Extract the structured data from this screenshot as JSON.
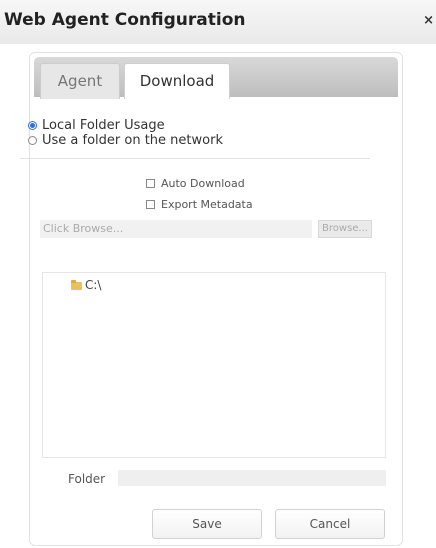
{
  "window": {
    "title": "Web Agent Configuration",
    "close_glyph": "×"
  },
  "tabs": [
    {
      "label": "Agent",
      "active": false
    },
    {
      "label": "Download",
      "active": true
    }
  ],
  "storage": {
    "options": [
      {
        "label": "Local Folder Usage",
        "selected": true
      },
      {
        "label": "Use a folder on the network",
        "selected": false
      }
    ]
  },
  "checkboxes": [
    {
      "label": "Auto Download",
      "checked": false
    },
    {
      "label": "Export Metadata",
      "checked": false
    }
  ],
  "browse": {
    "placeholder": "Click Browse...",
    "button_label": "Browse..."
  },
  "tree": {
    "items": [
      {
        "label": "C:\\",
        "icon": "folder-icon"
      }
    ]
  },
  "folder": {
    "label": "Folder",
    "value": ""
  },
  "actions": {
    "save_label": "Save",
    "cancel_label": "Cancel"
  },
  "colors": {
    "accent": "#2c6fd6",
    "folder": "#e9c25a"
  }
}
